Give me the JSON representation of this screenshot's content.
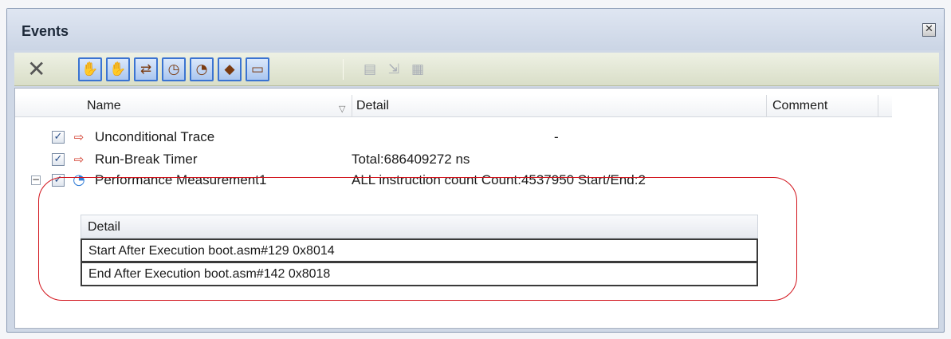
{
  "window": {
    "title": "Events",
    "close_glyph": "✕"
  },
  "toolbar": {
    "delete_glyph": "✕",
    "buttons": [
      {
        "icon": "hardware-break-icon",
        "glyph": "✋"
      },
      {
        "icon": "software-break-icon",
        "glyph": "✋"
      },
      {
        "icon": "trace-icon",
        "glyph": "⇄"
      },
      {
        "icon": "timer-icon",
        "glyph": "◷"
      },
      {
        "icon": "performance-icon",
        "glyph": "◔"
      },
      {
        "icon": "action-event-icon",
        "glyph": "◆"
      },
      {
        "icon": "printf-event-icon",
        "glyph": "▭"
      }
    ],
    "disabled_buttons": [
      {
        "icon": "edit-icon",
        "glyph": "▤"
      },
      {
        "icon": "import-icon",
        "glyph": "⇲"
      },
      {
        "icon": "export-icon",
        "glyph": "▦"
      }
    ]
  },
  "table": {
    "columns": [
      "Name",
      "Detail",
      "Comment"
    ],
    "sort_glyph": "▽",
    "rows": [
      {
        "checked": "✓",
        "icon": "trace-event-icon",
        "icon_glyph": "⇨",
        "name": "Unconditional Trace",
        "detail": "-",
        "comment": ""
      },
      {
        "checked": "✓",
        "icon": "timer-event-icon",
        "icon_glyph": "⇨",
        "name": "Run-Break Timer",
        "detail": "Total:686409272 ns",
        "comment": ""
      },
      {
        "checked": "✓",
        "icon": "performance-event-icon",
        "icon_glyph": "◔",
        "name": "Performance Measurement1",
        "detail": "ALL instruction count Count:4537950 Start/End:2",
        "comment": "",
        "expanded_glyph": "−"
      }
    ]
  },
  "subtable": {
    "header": "Detail",
    "rows": [
      "Start After Execution boot.asm#129 0x8014",
      "End After Execution boot.asm#142 0x8018"
    ]
  },
  "colors": {
    "highlight": "#d2141c",
    "toolbar_button_border": "#3b74d1"
  }
}
